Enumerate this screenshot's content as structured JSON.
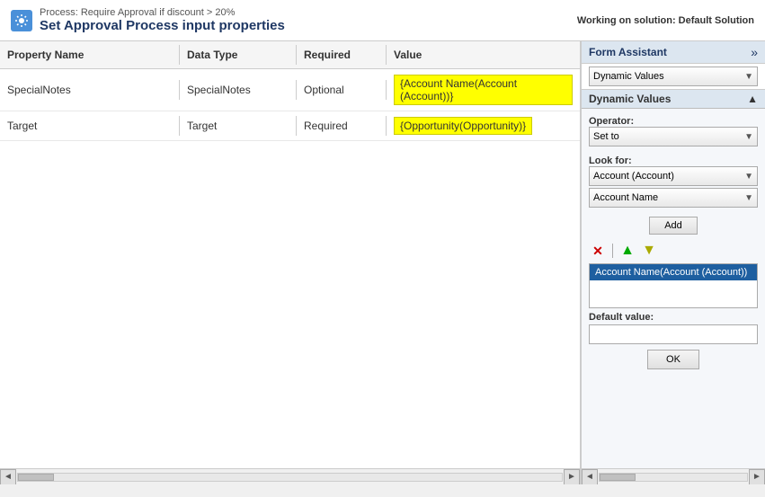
{
  "topBar": {
    "processLabel": "Process: Require Approval if discount > 20%",
    "pageTitle": "Set Approval Process input properties",
    "workingOn": "Working on solution: Default Solution",
    "gearIcon": "⚙"
  },
  "table": {
    "columns": {
      "propertyName": "Property Name",
      "dataType": "Data Type",
      "required": "Required",
      "value": "Value"
    },
    "rows": [
      {
        "propertyName": "SpecialNotes",
        "dataType": "SpecialNotes",
        "required": "Optional",
        "value": "{Account Name(Account (Account))}"
      },
      {
        "propertyName": "Target",
        "dataType": "Target",
        "required": "Required",
        "value": "{Opportunity(Opportunity)}"
      }
    ]
  },
  "formAssistant": {
    "title": "Form Assistant",
    "expandIcon": "»",
    "dynamicValuesSelect": "Dynamic Values",
    "dynamicValuesSectionLabel": "Dynamic Values",
    "collapseIcon": "▲",
    "operatorLabel": "Operator:",
    "operatorValue": "Set to",
    "lookForLabel": "Look for:",
    "lookForValue": "Account (Account)",
    "fieldValue": "Account Name",
    "addButtonLabel": "Add",
    "deleteIcon": "✕",
    "upIcon": "▲",
    "downIcon": "▼",
    "valueListItem": "Account Name(Account (Account))",
    "defaultValueLabel": "Default value:",
    "defaultValuePlaceholder": "",
    "okButtonLabel": "OK"
  },
  "scrollbar": {
    "leftArrow": "◄",
    "rightArrow": "►"
  }
}
